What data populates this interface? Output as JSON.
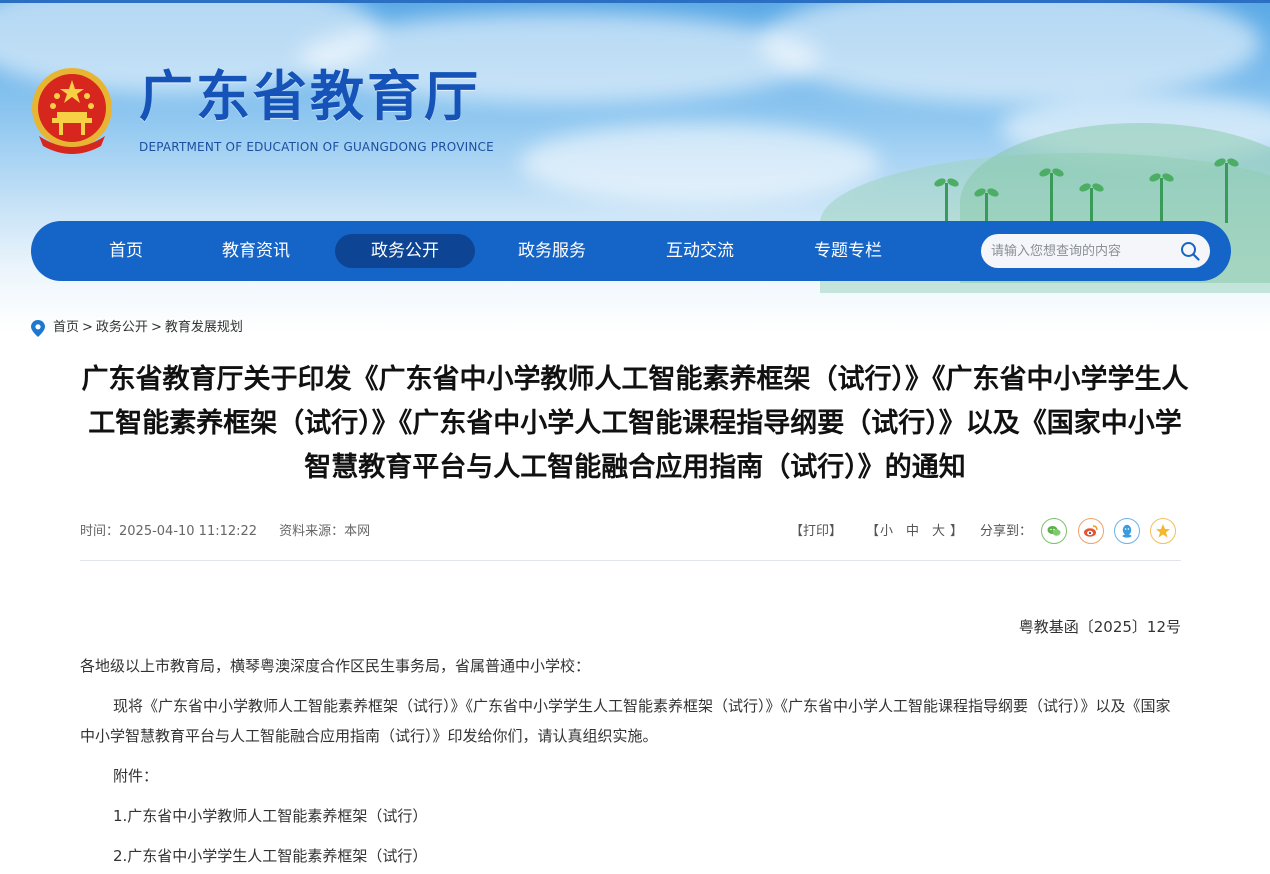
{
  "header": {
    "site_title": "广东省教育厅",
    "site_subtitle": "DEPARTMENT OF EDUCATION OF GUANGDONG PROVINCE",
    "emblem_icon": "national-emblem-icon",
    "brand_color": "#1565c8"
  },
  "nav": {
    "items": [
      {
        "label": "首页",
        "active": false
      },
      {
        "label": "教育资讯",
        "active": false
      },
      {
        "label": "政务公开",
        "active": true
      },
      {
        "label": "政务服务",
        "active": false
      },
      {
        "label": "互动交流",
        "active": false
      },
      {
        "label": "专题专栏",
        "active": false
      }
    ],
    "search_placeholder": "请输入您想查询的内容",
    "search_icon": "search-icon"
  },
  "breadcrumb": {
    "icon": "location-pin-icon",
    "items": [
      "首页",
      "政务公开",
      "教育发展规划"
    ],
    "separator": ">"
  },
  "article": {
    "title": "广东省教育厅关于印发《广东省中小学教师人工智能素养框架（试行）》《广东省中小学学生人工智能素养框架（试行）》《广东省中小学人工智能课程指导纲要（试行）》以及《国家中小学智慧教育平台与人工智能融合应用指南（试行）》的通知",
    "meta": {
      "time": "时间：2025-04-10 11:12:22",
      "source": "资料来源：本网"
    },
    "tools": {
      "print": "【打印】",
      "font_open": "【",
      "font_small": "小",
      "font_medium": "中",
      "font_large": "大",
      "font_close": "】",
      "share_label": "分享到："
    },
    "share_icons": [
      "wechat-icon",
      "weibo-icon",
      "qq-icon",
      "qzone-icon"
    ],
    "doc_number": "粤教基函〔2025〕12号",
    "recipients": "各地级以上市教育局，横琴粤澳深度合作区民生事务局，省属普通中小学校：",
    "body": "现将《广东省中小学教师人工智能素养框架（试行）》《广东省中小学学生人工智能素养框架（试行）》《广东省中小学人工智能课程指导纲要（试行）》以及《国家中小学智慧教育平台与人工智能融合应用指南（试行）》印发给你们，请认真组织实施。",
    "attachments_label": "附件：",
    "attachments": [
      "1.广东省中小学教师人工智能素养框架（试行）",
      "2.广东省中小学学生人工智能素养框架（试行）"
    ]
  }
}
